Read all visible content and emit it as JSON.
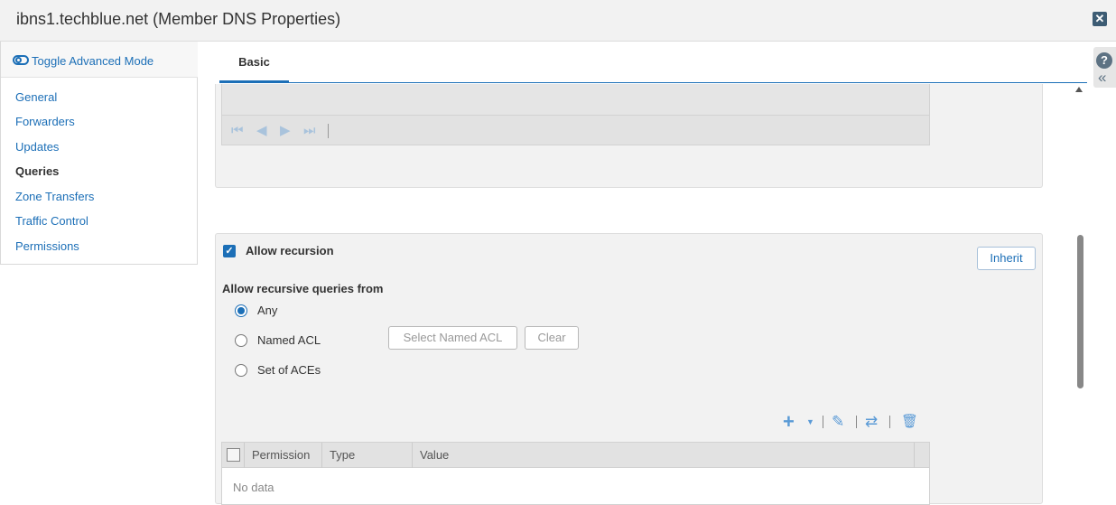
{
  "window": {
    "title": "ibns1.techblue.net (Member DNS Properties)"
  },
  "sidebar": {
    "toggle_label": "Toggle Advanced Mode",
    "items": [
      {
        "label": "General"
      },
      {
        "label": "Forwarders"
      },
      {
        "label": "Updates"
      },
      {
        "label": "Queries",
        "active": true
      },
      {
        "label": "Zone Transfers"
      },
      {
        "label": "Traffic Control"
      },
      {
        "label": "Permissions"
      }
    ]
  },
  "tabs": [
    {
      "label": "Basic",
      "active": true
    }
  ],
  "recursion": {
    "checkbox_label": "Allow recursion",
    "checked": true,
    "inherit_label": "Inherit",
    "section_label": "Allow recursive queries from",
    "options": [
      {
        "label": "Any",
        "checked": true
      },
      {
        "label": "Named ACL",
        "checked": false
      },
      {
        "label": "Set of ACEs",
        "checked": false
      }
    ],
    "select_acl_label": "Select Named ACL",
    "clear_label": "Clear"
  },
  "ace_grid": {
    "columns": [
      "Permission",
      "Type",
      "Value"
    ],
    "empty_text": "No data"
  },
  "icons": {
    "close": "close-icon",
    "help": "help-icon",
    "collapse": "double-chevron-left-icon",
    "add": "plus-icon",
    "edit": "edit-icon",
    "reorder": "swap-icon",
    "delete": "trash-icon"
  },
  "colors": {
    "accent": "#1c6fb7",
    "panel_bg": "#f2f2f2"
  }
}
